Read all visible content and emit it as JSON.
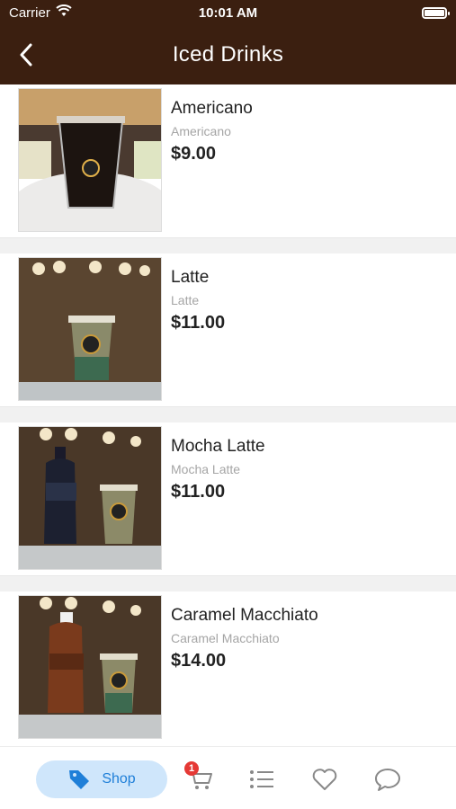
{
  "status_bar": {
    "carrier": "Carrier",
    "time": "10:01 AM"
  },
  "nav": {
    "title": "Iced Drinks"
  },
  "products": [
    {
      "name": "Americano",
      "subtitle": "Americano",
      "price": "$9.00"
    },
    {
      "name": "Latte",
      "subtitle": "Latte",
      "price": "$11.00"
    },
    {
      "name": "Mocha Latte",
      "subtitle": "Mocha Latte",
      "price": "$11.00"
    },
    {
      "name": "Caramel Macchiato",
      "subtitle": "Caramel Macchiato",
      "price": "$14.00"
    }
  ],
  "tab_bar": {
    "shop_label": "Shop",
    "cart_badge": "1",
    "icons": [
      "tag-icon",
      "cart-icon",
      "list-icon",
      "heart-icon",
      "chat-icon"
    ]
  },
  "colors": {
    "header": "#3b1f10",
    "accent": "#1f7fd8",
    "shop_pill": "#cfe6fb",
    "badge": "#e53935"
  }
}
